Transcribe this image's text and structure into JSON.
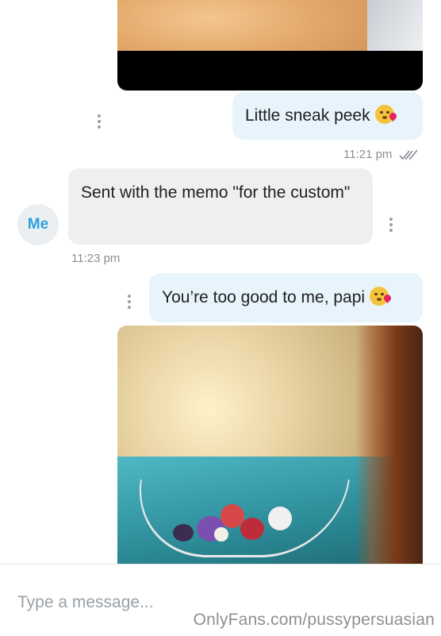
{
  "messages": [
    {
      "text": "Little sneak peek",
      "time": "11:21 pm",
      "direction": "outgoing",
      "status": "read"
    },
    {
      "text": "Sent with the memo \"for the custom\"",
      "time": "11:23 pm",
      "direction": "incoming"
    },
    {
      "text": "You’re too good to me, papi",
      "direction": "outgoing"
    }
  ],
  "avatar": {
    "label": "Me"
  },
  "composer": {
    "placeholder": "Type a message..."
  },
  "watermark": "OnlyFans.com/pussypersuasian",
  "icons": {
    "emoji": "kissing-face-with-heart-icon",
    "more": "more-vertical-icon",
    "read_receipt": "double-check-icon"
  },
  "colors": {
    "outgoing_bubble": "#e7f4fb",
    "incoming_bubble": "#eeeff1",
    "accent": "#2ea0d8"
  }
}
